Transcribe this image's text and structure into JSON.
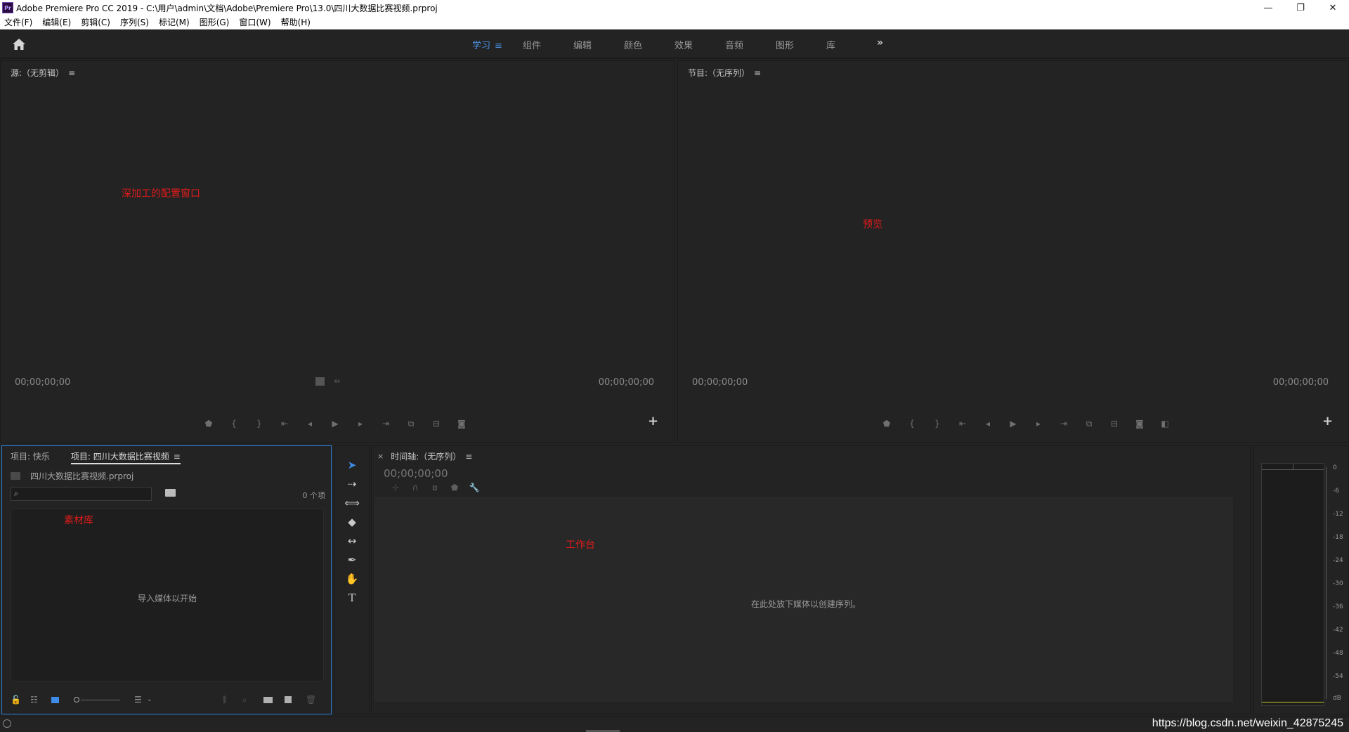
{
  "window": {
    "title": "Adobe Premiere Pro CC 2019 - C:\\用户\\admin\\文档\\Adobe\\Premiere Pro\\13.0\\四川大数据比赛视频.prproj",
    "app_icon_text": "Pr",
    "minimize": "—",
    "restore": "❐",
    "close": "✕"
  },
  "menubar": {
    "items": [
      "文件(F)",
      "编辑(E)",
      "剪辑(C)",
      "序列(S)",
      "标记(M)",
      "图形(G)",
      "窗口(W)",
      "帮助(H)"
    ]
  },
  "workspaces": {
    "tabs": [
      "学习",
      "组件",
      "编辑",
      "颜色",
      "效果",
      "音频",
      "图形",
      "库"
    ],
    "active": "学习",
    "menu_glyph": "≡",
    "more_glyph": "»",
    "home_icon": "home-icon"
  },
  "source_panel": {
    "title": "源:（无剪辑）",
    "menu_glyph": "≡",
    "annotation": "深加工的配置窗口",
    "timecode_left": "00;00;00;00",
    "timecode_right": "00;00;00;00",
    "add_button": "+"
  },
  "program_panel": {
    "title": "节目:（无序列）",
    "menu_glyph": "≡",
    "annotation": "预览",
    "timecode_left": "00;00;00;00",
    "timecode_right": "00;00;00;00",
    "add_button": "+"
  },
  "project_panel": {
    "tabs": [
      "项目: 快乐",
      "项目: 四川大数据比赛视频"
    ],
    "active_tab": "项目: 四川大数据比赛视频",
    "menu_glyph": "≡",
    "file_name": "四川大数据比赛视频.prproj",
    "search_placeholder": "",
    "item_count": "0 个项",
    "empty_text": "导入媒体以开始",
    "annotation": "素材库"
  },
  "timeline_panel": {
    "title": "时间轴:（无序列）",
    "close_glyph": "×",
    "menu_glyph": "≡",
    "timecode": "00;00;00;00",
    "drop_text": "在此处放下媒体以创建序列。",
    "annotation": "工作台"
  },
  "audio_meter": {
    "ticks": [
      "0",
      "-6",
      "-12",
      "-18",
      "-24",
      "-30",
      "-36",
      "-42",
      "-48",
      "-54",
      "dB"
    ]
  },
  "statusbar": {
    "watermark": "https://blog.csdn.net/weixin_42875245"
  },
  "colors": {
    "accent_blue": "#4a90e2",
    "annotation_red": "#e01b1b",
    "panel_bg": "#232323"
  }
}
